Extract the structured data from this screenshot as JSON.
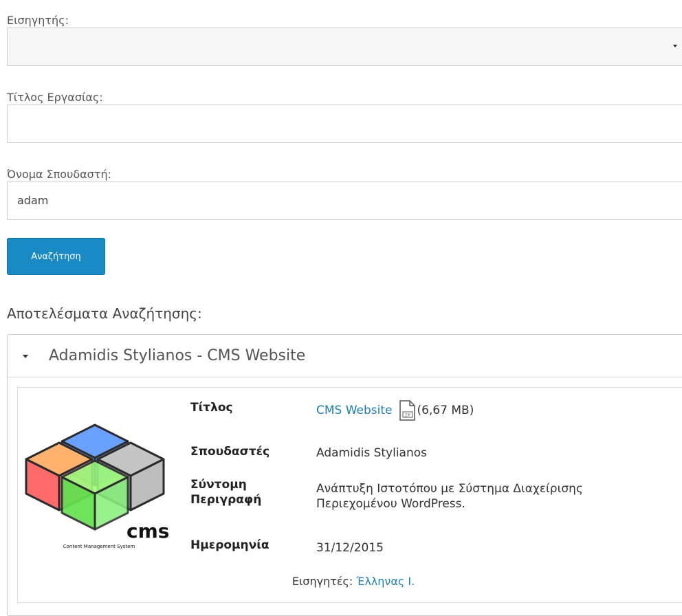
{
  "form": {
    "advisor_label": "Εισηγητής:",
    "advisor_selected": "",
    "title_label": "Τίτλος Εργασίας:",
    "title_value": "",
    "student_label": "Όνομα Σπουδαστή:",
    "student_value": "adam",
    "search_button": "Αναζήτηση"
  },
  "results": {
    "heading": "Αποτελέσματα Αναζήτησης:",
    "items": [
      {
        "header": "Adamidis Stylianos - CMS Website",
        "logo_caption": "Content Management System",
        "logo_text": "cms",
        "fields": {
          "title_label": "Τίτλος",
          "title_link": "CMS Website",
          "file_size": "(6,67 MB)",
          "students_label": "Σπουδαστές",
          "students_value": "Adamidis Stylianos",
          "summary_label_1": "Σύντομη",
          "summary_label_2": "Περιγραφή",
          "summary_line_1": "Ανάπτυξη Ιστοτόπου με Σύστημα Διαχείρισης",
          "summary_line_2": "Περιεχομένου WordPress.",
          "date_label": "Ημερομηνία",
          "date_value": "31/12/2015"
        },
        "advisor_prefix": "Εισηγητές:",
        "advisor_link": "Έλληνας Ι."
      }
    ]
  },
  "icons": {
    "zip": "zip-file-icon",
    "caret": "caret-down-icon"
  },
  "colors": {
    "primary_button": "#1a8ac4",
    "link": "#1f7fb5"
  }
}
